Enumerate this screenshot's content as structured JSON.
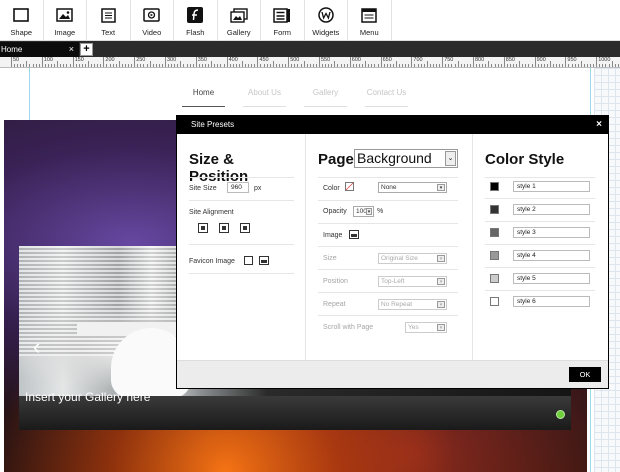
{
  "toolbar": {
    "items": [
      {
        "label": "Shape",
        "icon": "shape-icon"
      },
      {
        "label": "Image",
        "icon": "image-icon"
      },
      {
        "label": "Text",
        "icon": "text-icon"
      },
      {
        "label": "Video",
        "icon": "video-icon"
      },
      {
        "label": "Flash",
        "icon": "flash-icon"
      },
      {
        "label": "Gallery",
        "icon": "gallery-icon"
      },
      {
        "label": "Form",
        "icon": "form-icon"
      },
      {
        "label": "Widgets",
        "icon": "widgets-icon"
      },
      {
        "label": "Menu",
        "icon": "menu-icon"
      }
    ]
  },
  "tabs": {
    "active": "Home",
    "close": "×",
    "add": "+"
  },
  "ruler": {
    "labels": [
      "50",
      "100",
      "150",
      "200",
      "250",
      "300",
      "350",
      "400",
      "450",
      "500",
      "550",
      "600",
      "650",
      "700",
      "750",
      "800",
      "850",
      "900",
      "950",
      "1000"
    ]
  },
  "site": {
    "nav": [
      "Home",
      "About Us",
      "Gallery",
      "Contact Us"
    ],
    "gallery_caption": "Insert your Gallery here",
    "gallery_arrow": "‹"
  },
  "modal": {
    "title": "Site Presets",
    "close": "×",
    "ok": "OK",
    "size_position": {
      "title": "Size & Position",
      "site_size_label": "Site Size",
      "site_size_value": "960",
      "site_size_unit": "px",
      "alignment_label": "Site Alignment",
      "favicon_label": "Favicon Image"
    },
    "page_background": {
      "title_prefix": "Page",
      "title_select": "Background",
      "color_label": "Color",
      "color_value": "None",
      "opacity_label": "Opacity",
      "opacity_value": "100",
      "opacity_unit": "%",
      "image_label": "Image",
      "size_label": "Size",
      "size_value": "Original Size",
      "position_label": "Position",
      "position_value": "Top-Left",
      "repeat_label": "Repeat",
      "repeat_value": "No Repeat",
      "scroll_label": "Scroll with Page",
      "scroll_value": "Yes"
    },
    "color_style": {
      "title": "Color Style",
      "styles": [
        {
          "name": "style 1",
          "color": "#000000"
        },
        {
          "name": "style 2",
          "color": "#333333"
        },
        {
          "name": "style 3",
          "color": "#666666"
        },
        {
          "name": "style 4",
          "color": "#999999"
        },
        {
          "name": "style 5",
          "color": "#cccccc"
        },
        {
          "name": "style 6",
          "color": "#ffffff"
        }
      ]
    }
  }
}
